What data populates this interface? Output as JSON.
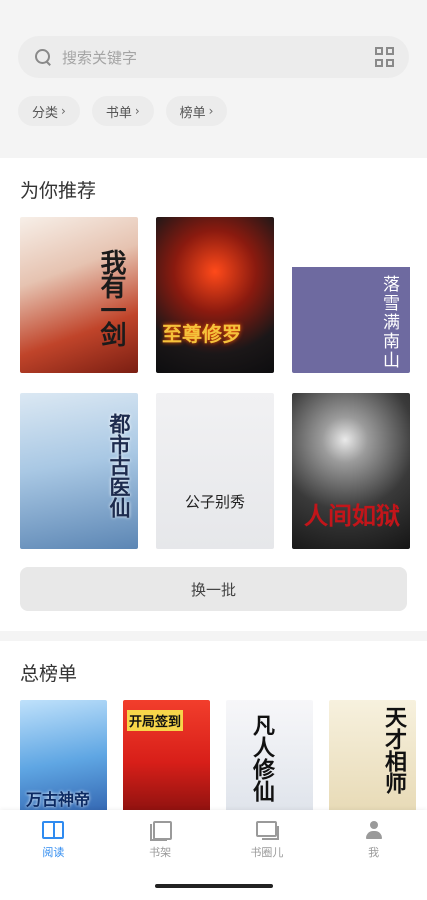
{
  "search": {
    "placeholder": "搜索关键字",
    "left_icon": "search-icon",
    "right_icon": "scan-icon"
  },
  "chips": [
    {
      "label": "分类"
    },
    {
      "label": "书单"
    },
    {
      "label": "榜单"
    }
  ],
  "recommend": {
    "title": "为你推荐",
    "books": [
      {
        "title": "我有一剑"
      },
      {
        "title": "至尊修罗"
      },
      {
        "title": "落雪满南山"
      },
      {
        "title": "都市古医仙"
      },
      {
        "title": "公子别秀"
      },
      {
        "title": "人间如狱"
      }
    ],
    "change_label": "换一批"
  },
  "ranking": {
    "title": "总榜单",
    "books": [
      {
        "title": "万古神帝"
      },
      {
        "title": "开局签到"
      },
      {
        "title": "凡人修仙"
      },
      {
        "title": "天才相师"
      }
    ]
  },
  "tabbar": {
    "items": [
      {
        "label": "阅读",
        "icon": "book-open-icon",
        "active": true
      },
      {
        "label": "书架",
        "icon": "bookshelf-icon",
        "active": false
      },
      {
        "label": "书圈儿",
        "icon": "chat-bubbles-icon",
        "active": false
      },
      {
        "label": "我",
        "icon": "person-icon",
        "active": false
      }
    ]
  },
  "colors": {
    "accent": "#2f8bf0",
    "inactive": "#9a9a9a"
  }
}
